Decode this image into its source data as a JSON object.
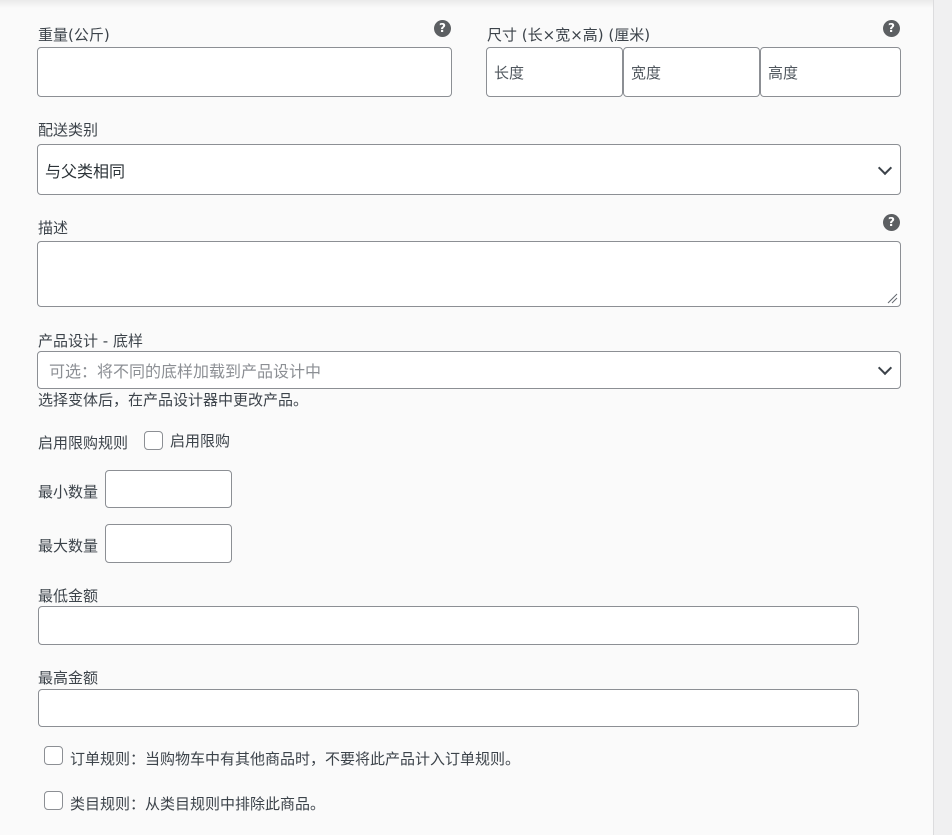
{
  "weight": {
    "label": "重量(公斤)",
    "help": "?",
    "value": ""
  },
  "dimensions": {
    "label": "尺寸 (长×宽×高) (厘米)",
    "help": "?",
    "length_placeholder": "长度",
    "width_placeholder": "宽度",
    "height_placeholder": "高度"
  },
  "shipping_class": {
    "label": "配送类别",
    "selected": "与父类相同"
  },
  "description": {
    "label": "描述",
    "help": "?",
    "value": ""
  },
  "design_template": {
    "label": "产品设计 - 底样",
    "placeholder": "可选：将不同的底样加载到产品设计中",
    "note": "选择变体后，在产品设计器中更改产品。"
  },
  "purchase_limit": {
    "label": "启用限购规则",
    "checkbox_label": "启用限购"
  },
  "min_qty": {
    "label": "最小数量",
    "value": ""
  },
  "max_qty": {
    "label": "最大数量",
    "value": ""
  },
  "min_amount": {
    "label": "最低金额",
    "value": ""
  },
  "max_amount": {
    "label": "最高金额",
    "value": ""
  },
  "order_rule": {
    "label": "订单规则：",
    "text": "当购物车中有其他商品时，不要将此产品计入订单规则。"
  },
  "category_rule": {
    "label": "类目规则：",
    "text": "从类目规则中排除此商品。"
  }
}
